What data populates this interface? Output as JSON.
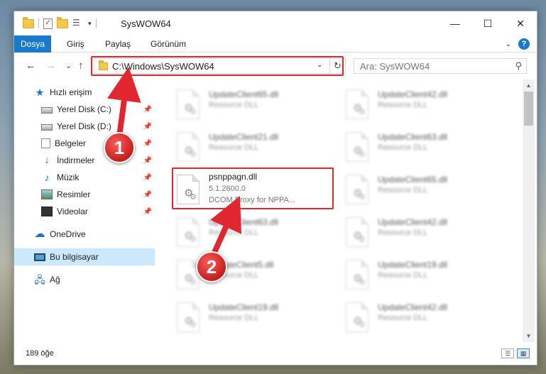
{
  "window": {
    "title": "SysWOW64",
    "controls": {
      "minimize": "—",
      "maximize": "☐",
      "close": "✕"
    }
  },
  "ribbon": {
    "tabs": [
      "Dosya",
      "Giriş",
      "Paylaş",
      "Görünüm"
    ],
    "help": "?"
  },
  "nav": {
    "back": "←",
    "forward": "→",
    "recent": "⌄",
    "up": "↑",
    "address": "C:\\Windows\\SysWOW64",
    "dropdown": "⌄",
    "refresh": "↻",
    "search_placeholder": "Ara: SysWOW64",
    "search_icon": "⚲"
  },
  "sidebar": {
    "items": [
      {
        "label": "Hızlı erişim",
        "icon": "star-icon"
      },
      {
        "label": "Yerel Disk (C:)",
        "icon": "drive-icon",
        "pinned": true
      },
      {
        "label": "Yerel Disk (D:)",
        "icon": "drive-icon",
        "pinned": true
      },
      {
        "label": "Belgeler",
        "icon": "documents-icon",
        "pinned": true
      },
      {
        "label": "İndirmeler",
        "icon": "download-icon",
        "pinned": true
      },
      {
        "label": "Müzik",
        "icon": "music-icon",
        "pinned": true
      },
      {
        "label": "Resimler",
        "icon": "pictures-icon",
        "pinned": true
      },
      {
        "label": "Videolar",
        "icon": "video-icon",
        "pinned": true
      },
      {
        "label": "OneDrive",
        "icon": "cloud-icon"
      },
      {
        "label": "Bu bilgisayar",
        "icon": "computer-icon",
        "selected": true
      },
      {
        "label": "Ağ",
        "icon": "network-icon"
      }
    ],
    "pin_glyph": "📌"
  },
  "files": {
    "left": [
      {
        "name": "UpdateClient65.dll",
        "desc": "Resource DLL"
      },
      {
        "name": "UpdateClient21.dll",
        "desc": "Resource DLL"
      },
      {
        "name": "psnppagn.dll",
        "version": "5.1.2600.0",
        "desc": "DCOM Proxy for NPPA...",
        "highlighted": true
      },
      {
        "name": "UpdateClient63.dll",
        "desc": "Resource DLL"
      },
      {
        "name": "UpdateClient5.dll",
        "desc": "Resource DLL"
      },
      {
        "name": "UpdateClient19.dll",
        "desc": "Resource DLL"
      }
    ],
    "right": [
      {
        "name": "UpdateClient42.dll",
        "desc": "Resource DLL"
      },
      {
        "name": "UpdateClient63.dll",
        "desc": "Resource DLL"
      },
      {
        "name": "UpdateClient65.dll",
        "desc": "Resource DLL"
      },
      {
        "name": "UpdateClient42.dll",
        "desc": "Resource DLL"
      },
      {
        "name": "UpdateClient19.dll",
        "desc": "Resource DLL"
      },
      {
        "name": "UpdateClient42.dll",
        "desc": "Resource DLL"
      }
    ]
  },
  "status": {
    "item_count": "189 öğe"
  },
  "annotations": {
    "step1": "1",
    "step2": "2",
    "color": "#e0262f"
  }
}
